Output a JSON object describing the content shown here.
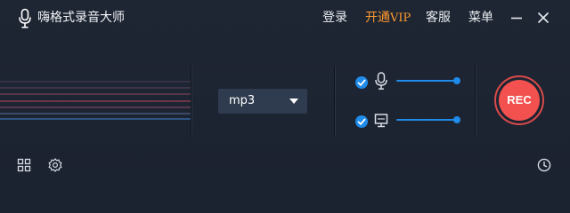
{
  "app": {
    "title": "嗨格式录音大师",
    "logo_icon": "microphone-icon"
  },
  "nav": {
    "login": "登录",
    "vip_prefix": "开通",
    "vip_suffix": "VIP",
    "service": "客服",
    "menu": "菜单"
  },
  "window_controls": [
    "minimize-icon",
    "close-icon"
  ],
  "colors": {
    "background": "#1c2330",
    "accent": "#1f8bea",
    "vip": "#ff9a2e",
    "record": "#f2514f"
  },
  "format": {
    "selected": "mp3"
  },
  "sources": {
    "microphone": {
      "checked": true,
      "icon": "microphone-icon",
      "volume": 1.0
    },
    "system_audio": {
      "checked": true,
      "icon": "monitor-icon",
      "volume": 1.0
    }
  },
  "record": {
    "label": "REC"
  },
  "footer": {
    "icons": [
      "grid-icon",
      "gear-icon",
      "clock-icon"
    ]
  }
}
